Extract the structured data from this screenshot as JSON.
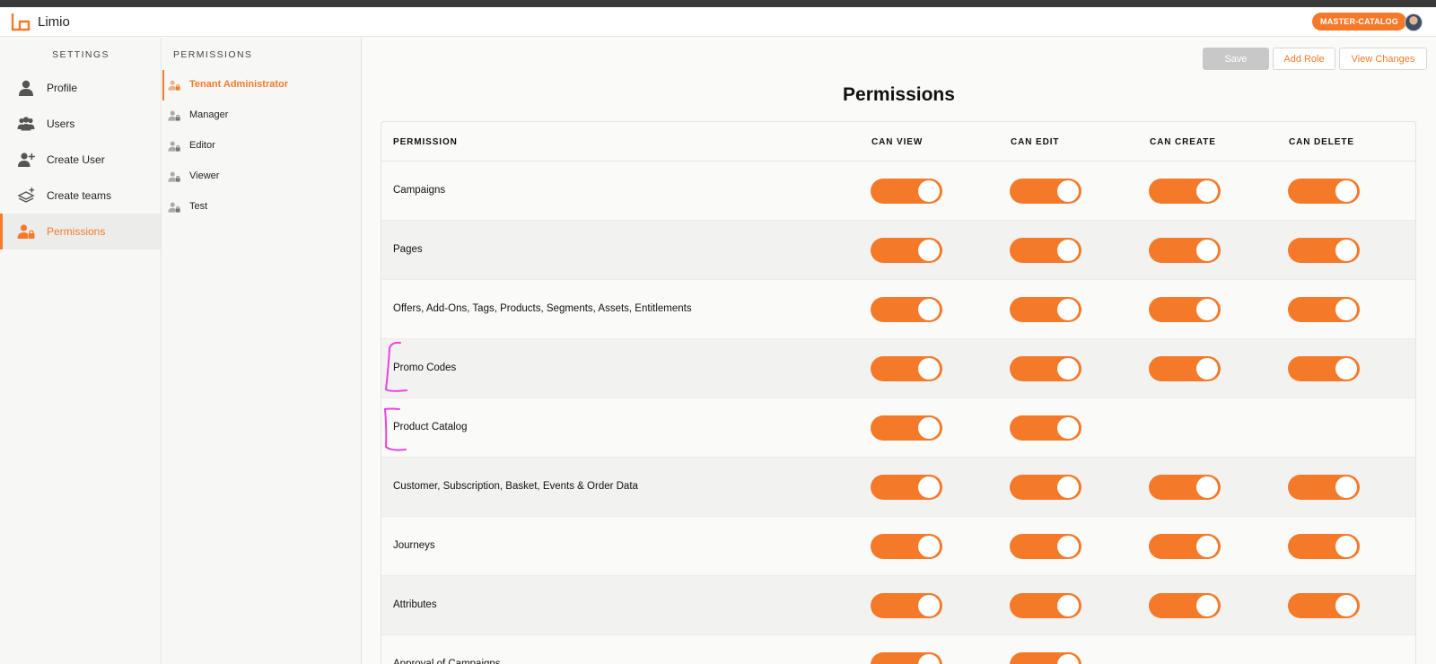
{
  "app": {
    "brand": "Limio",
    "tenant_badge": "MASTER-CATALOG"
  },
  "colors": {
    "accent": "#f47a2a",
    "annotation": "#f040e0"
  },
  "settings_nav": {
    "title": "SETTINGS",
    "items": [
      {
        "label": "Profile",
        "icon": "person-icon"
      },
      {
        "label": "Users",
        "icon": "users-icon"
      },
      {
        "label": "Create User",
        "icon": "user-add-icon"
      },
      {
        "label": "Create teams",
        "icon": "layers-icon"
      },
      {
        "label": "Permissions",
        "icon": "user-lock-icon",
        "active": true
      }
    ]
  },
  "roles_nav": {
    "title": "PERMISSIONS",
    "items": [
      {
        "label": "Tenant Administrator",
        "active": true
      },
      {
        "label": "Manager"
      },
      {
        "label": "Editor"
      },
      {
        "label": "Viewer"
      },
      {
        "label": "Test"
      }
    ]
  },
  "toolbar": {
    "save_label": "Save",
    "add_role_label": "Add Role",
    "view_changes_label": "View Changes"
  },
  "page": {
    "title": "Permissions"
  },
  "table": {
    "headers": [
      "PERMISSION",
      "CAN VIEW",
      "CAN EDIT",
      "CAN CREATE",
      "CAN DELETE"
    ],
    "rows": [
      {
        "name": "Campaigns",
        "view": true,
        "edit": true,
        "create": true,
        "delete": true
      },
      {
        "name": "Pages",
        "view": true,
        "edit": true,
        "create": true,
        "delete": true
      },
      {
        "name": "Offers, Add-Ons, Tags, Products, Segments, Assets, Entitlements",
        "view": true,
        "edit": true,
        "create": true,
        "delete": true
      },
      {
        "name": "Promo Codes",
        "view": true,
        "edit": true,
        "create": true,
        "delete": true
      },
      {
        "name": "Product Catalog",
        "view": true,
        "edit": true
      },
      {
        "name": "Customer, Subscription, Basket, Events & Order Data",
        "view": true,
        "edit": true,
        "create": true,
        "delete": true
      },
      {
        "name": "Journeys",
        "view": true,
        "edit": true,
        "create": true,
        "delete": true
      },
      {
        "name": "Attributes",
        "view": true,
        "edit": true,
        "create": true,
        "delete": true
      },
      {
        "name": "Approval of Campaigns",
        "view": true,
        "edit": true
      }
    ]
  }
}
